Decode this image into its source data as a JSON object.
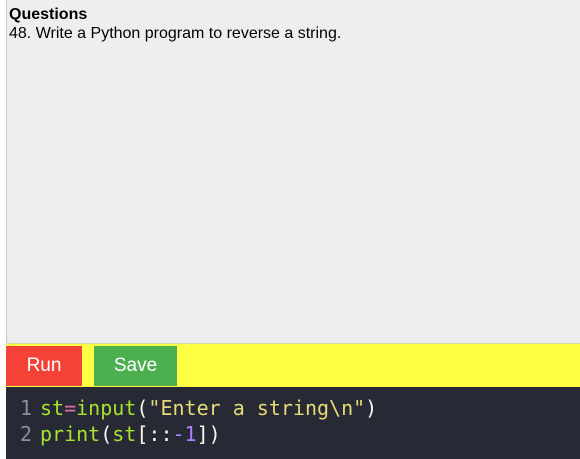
{
  "question_panel": {
    "heading": "Questions",
    "text": "48. Write a Python program to reverse a string."
  },
  "toolbar": {
    "run_label": "Run",
    "save_label": "Save",
    "background_color": "#ffff44",
    "run_color": "#f44336",
    "save_color": "#4caf50"
  },
  "editor": {
    "background_color": "#272a35",
    "lines": [
      {
        "number": "1",
        "tokens": {
          "t0": "st",
          "t1": "=",
          "t2": "input",
          "t3": "(",
          "t4": "\"Enter a string\\n\"",
          "t5": ")"
        }
      },
      {
        "number": "2",
        "tokens": {
          "t0": "print",
          "t1": "(",
          "t2": "st",
          "t3": "[::",
          "t4": "-1",
          "t5": "])"
        }
      }
    ]
  }
}
